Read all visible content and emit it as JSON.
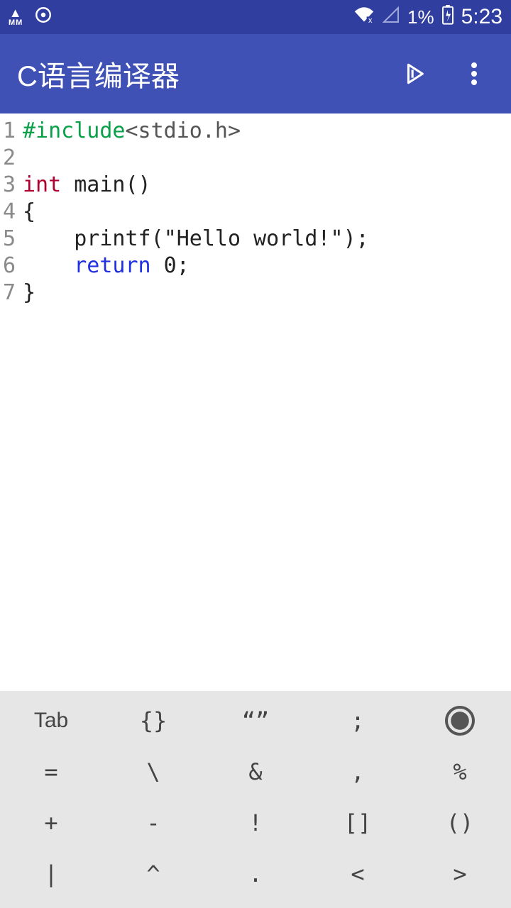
{
  "status": {
    "left_mm": "MM",
    "battery": "1%",
    "time": "5:23"
  },
  "appbar": {
    "title": "C语言编译器"
  },
  "code": {
    "lines": [
      {
        "n": "1",
        "html": "<span class='tok-pre'>#include</span><span class='tok-angle'>&lt;stdio.h&gt;</span>"
      },
      {
        "n": "2",
        "html": ""
      },
      {
        "n": "3",
        "html": "<span class='tok-kw'>int</span> main()"
      },
      {
        "n": "4",
        "html": "{"
      },
      {
        "n": "5",
        "html": "    printf(<span class='tok-str'>\"Hello world!\"</span>);"
      },
      {
        "n": "6",
        "html": "    <span class='tok-kw2'>return</span> 0;"
      },
      {
        "n": "7",
        "html": "}"
      }
    ]
  },
  "keyboard": {
    "rows": [
      [
        "Tab",
        "{}",
        "“”",
        ";",
        "●"
      ],
      [
        "=",
        "\\",
        "&",
        ",",
        "%"
      ],
      [
        "+",
        "-",
        "!",
        "[]",
        "()"
      ],
      [
        "|",
        "^",
        ".",
        "<",
        ">"
      ]
    ]
  }
}
